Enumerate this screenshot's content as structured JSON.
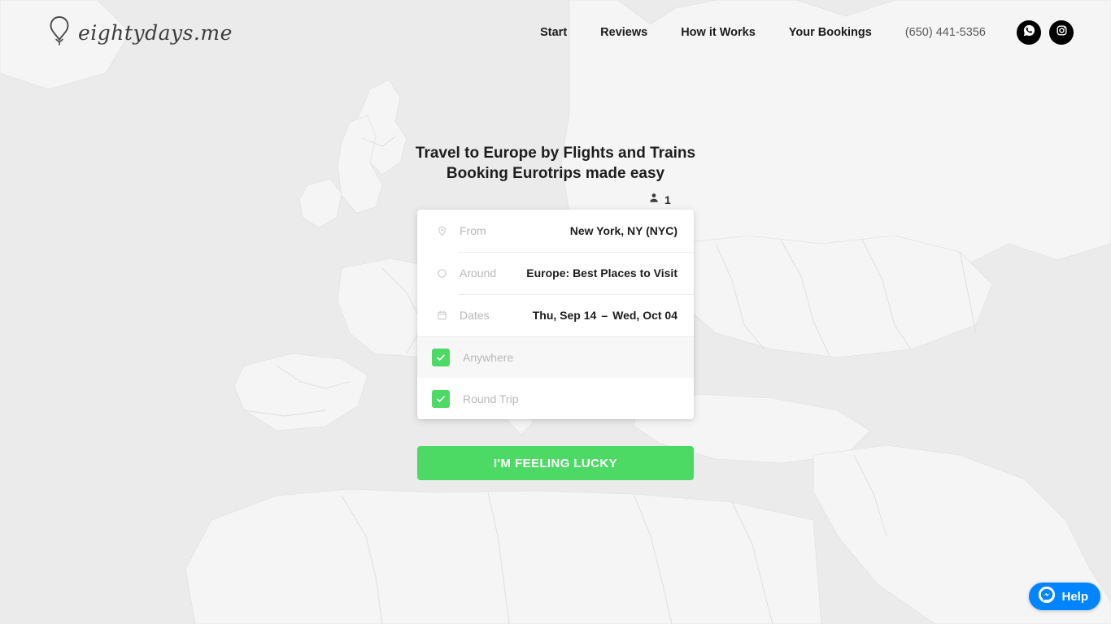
{
  "header": {
    "brand": {
      "wordmark": "eightydays.me",
      "logo_icon": "balloon-pin-icon"
    },
    "nav_items": [
      {
        "label": "Start",
        "name": "nav-start"
      },
      {
        "label": "Reviews",
        "name": "nav-reviews"
      },
      {
        "label": "How it Works",
        "name": "nav-how-it-works"
      },
      {
        "label": "Your Bookings",
        "name": "nav-your-bookings"
      }
    ],
    "phone": "(650) 441-5356",
    "social": [
      {
        "name": "whatsapp-icon",
        "label": "WhatsApp"
      },
      {
        "name": "instagram-icon",
        "label": "Instagram"
      }
    ]
  },
  "hero": {
    "heading_line1": "Travel to Europe by Flights and Trains",
    "heading_line2": "Booking Eurotrips made easy"
  },
  "passengers": {
    "icon": "person-icon",
    "count": "1"
  },
  "search_card": {
    "fields": [
      {
        "icon": "map-pin-icon",
        "label": "From",
        "value": "New York, NY (NYC)"
      },
      {
        "icon": "circle-outline-icon",
        "label": "Around",
        "value": "Europe: Best Places to Visit"
      },
      {
        "icon": "calendar-icon",
        "label": "Dates",
        "value": "Thu, Sep 14",
        "value_end": "Wed, Oct 04",
        "separator": "–"
      }
    ],
    "options": [
      {
        "label": "Anywhere",
        "checked": true
      },
      {
        "label": "Round Trip",
        "checked": true
      }
    ]
  },
  "cta": {
    "label": "I'M FEELING LUCKY"
  },
  "help_widget": {
    "label": "Help",
    "icon": "messenger-icon"
  },
  "colors": {
    "accent_green": "#4cd964",
    "messenger_blue": "#0084ff",
    "page_background": "#ebebeb",
    "map_land": "#f5f5f5",
    "text_dark": "#1d1d1d",
    "text_muted": "#b8b8b8"
  }
}
